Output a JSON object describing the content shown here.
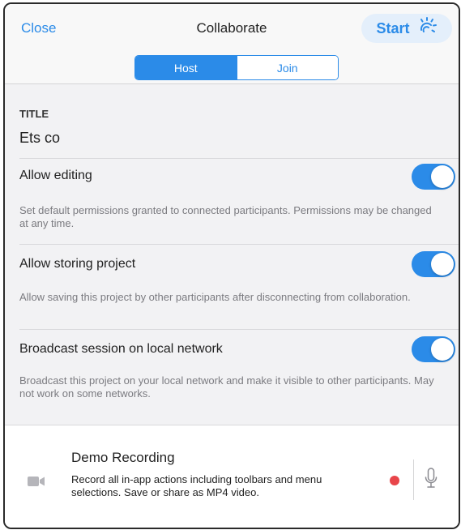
{
  "header": {
    "close_label": "Close",
    "title": "Collaborate",
    "start_label": "Start"
  },
  "segments": [
    {
      "label": "Host",
      "active": true
    },
    {
      "label": "Join",
      "active": false
    }
  ],
  "title_section": {
    "heading": "TITLE",
    "value": "Ets co"
  },
  "settings": [
    {
      "label": "Allow editing",
      "description": "Set default permissions granted to connected participants. Permissions may be changed at any time.",
      "enabled": true
    },
    {
      "label": "Allow storing project",
      "description": "Allow saving this project by other participants after disconnecting from collaboration.",
      "enabled": true
    },
    {
      "label": "Broadcast session on local network",
      "description": "Broadcast this project on your local network and make it visible to other participants. May not work on some networks.",
      "enabled": true
    }
  ],
  "demo": {
    "title": "Demo Recording",
    "description": "Record all in-app actions including toolbars and menu selections. Save or share as MP4 video."
  },
  "colors": {
    "accent": "#2b8be8",
    "record": "#e8454a",
    "background": "#f2f2f4"
  },
  "icons": {
    "start": "broadcast-sun-icon",
    "camera": "video-camera-icon",
    "record": "record-dot-icon",
    "mic": "microphone-icon"
  }
}
